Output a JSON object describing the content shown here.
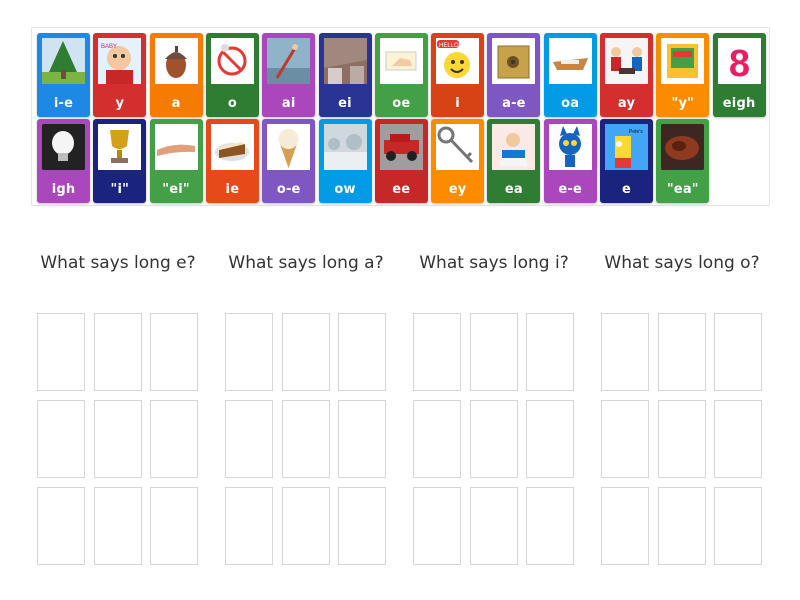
{
  "cards": [
    {
      "label": "i-e",
      "color": "#1e88e5",
      "picture": "pine-tree"
    },
    {
      "label": "y",
      "color": "#d32f2f",
      "picture": "baby"
    },
    {
      "label": "a",
      "color": "#f57c00",
      "picture": "acorn"
    },
    {
      "label": "o",
      "color": "#2e7d32",
      "picture": "no-sign-figure"
    },
    {
      "label": "ai",
      "color": "#ab47bc",
      "picture": "rain-figure"
    },
    {
      "label": "ei",
      "color": "#283593",
      "picture": "ceiling"
    },
    {
      "label": "oe",
      "color": "#43a047",
      "picture": "toe"
    },
    {
      "label": "i",
      "color": "#d84315",
      "picture": "hello-smiley"
    },
    {
      "label": "a-e",
      "color": "#7e57c2",
      "picture": "safe"
    },
    {
      "label": "oa",
      "color": "#039be5",
      "picture": "boat"
    },
    {
      "label": "ay",
      "color": "#d32f2f",
      "picture": "chess-players"
    },
    {
      "label": "\"y\"",
      "color": "#fb8c00",
      "picture": "book"
    },
    {
      "label": "eigh",
      "color": "#2e7d32",
      "picture": "number-eight"
    },
    {
      "label": "igh",
      "color": "#ab47bc",
      "picture": "light-bulb"
    },
    {
      "label": "\"i\"",
      "color": "#1a237e",
      "picture": "trophy"
    },
    {
      "label": "\"ei\"",
      "color": "#43a047",
      "picture": "arm"
    },
    {
      "label": "ie",
      "color": "#e64a19",
      "picture": "pie"
    },
    {
      "label": "o-e",
      "color": "#7e57c2",
      "picture": "ice-cream-cone"
    },
    {
      "label": "ow",
      "color": "#039be5",
      "picture": "snow"
    },
    {
      "label": "ee",
      "color": "#c62828",
      "picture": "jeep"
    },
    {
      "label": "ey",
      "color": "#fb8c00",
      "picture": "key"
    },
    {
      "label": "ea",
      "color": "#2e7d32",
      "picture": "reading"
    },
    {
      "label": "e-e",
      "color": "#ab47bc",
      "picture": "pete-cat"
    },
    {
      "label": "e",
      "color": "#1a237e",
      "picture": "bart"
    },
    {
      "label": "\"ea\"",
      "color": "#43a047",
      "picture": "steak"
    }
  ],
  "groups": [
    {
      "title": "What says long e?"
    },
    {
      "title": "What says long a?"
    },
    {
      "title": "What says long i?"
    },
    {
      "title": "What says long o?"
    }
  ],
  "picture_text": {
    "hello": "HELLO",
    "eight": "8",
    "pete": "Pete's"
  }
}
